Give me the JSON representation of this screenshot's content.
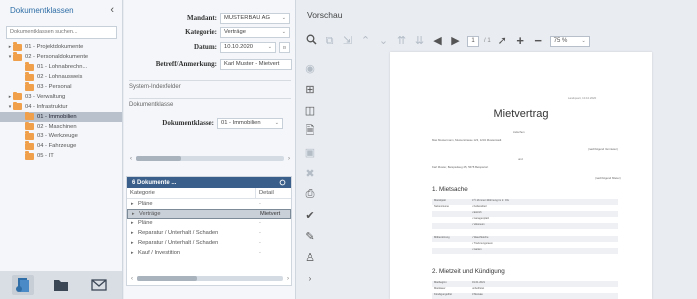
{
  "left": {
    "title": "Dokumentklassen",
    "collapse_icon": "chevron-left-icon",
    "search_placeholder": "Dokumentklassen suchen...",
    "tree": [
      {
        "label": "01 - Projektdokumente",
        "depth": 0,
        "toggle": "▸"
      },
      {
        "label": "02 - Personaldokumente",
        "depth": 0,
        "toggle": "▾"
      },
      {
        "label": "01 - Lohnabrechn...",
        "depth": 1,
        "toggle": ""
      },
      {
        "label": "02 - Lohnausweis",
        "depth": 1,
        "toggle": ""
      },
      {
        "label": "03 - Personal",
        "depth": 1,
        "toggle": ""
      },
      {
        "label": "03 - Verwaltung",
        "depth": 0,
        "toggle": "▸"
      },
      {
        "label": "04 - Infrastruktur",
        "depth": 0,
        "toggle": "▾"
      },
      {
        "label": "01 - Immobilien",
        "depth": 1,
        "toggle": "",
        "selected": true
      },
      {
        "label": "02 - Maschinen",
        "depth": 1,
        "toggle": ""
      },
      {
        "label": "03 - Werkzeuge",
        "depth": 1,
        "toggle": ""
      },
      {
        "label": "04 - Fahrzeuge",
        "depth": 1,
        "toggle": ""
      },
      {
        "label": "05 - IT",
        "depth": 1,
        "toggle": ""
      }
    ],
    "footer_icons": [
      "documents-icon",
      "folder-icon",
      "mail-icon"
    ]
  },
  "form": {
    "mandant_label": "Mandant:",
    "mandant_value": "MUSTERBAU AG",
    "kategorie_label": "Kategorie:",
    "kategorie_value": "Verträge",
    "datum_label": "Datum:",
    "datum_value": "10.10.2020",
    "betreff_label": "Betreff/Anmerkung:",
    "betreff_value": "Karl Muster - Mietvert",
    "section_system": "System-Indexfelder",
    "section_klasse": "Dokumentklasse",
    "dokumentklasse_label": "Dokumentklasse:",
    "dokumentklasse_value": "01 - Immobilien"
  },
  "docs": {
    "header": "6 Dokumente ...",
    "col_kategorie": "Kategorie",
    "col_detail": "Detail",
    "rows": [
      {
        "kategorie": "Pläne",
        "detail": "-"
      },
      {
        "kategorie": "Verträge",
        "detail": "Mietvert",
        "selected": true
      },
      {
        "kategorie": "Pläne",
        "detail": "-"
      },
      {
        "kategorie": "Reparatur / Unterhalt / Schaden",
        "detail": "-"
      },
      {
        "kategorie": "Reparatur / Unterhalt / Schaden",
        "detail": "-"
      },
      {
        "kategorie": "Kauf / Investition",
        "detail": "-"
      }
    ]
  },
  "preview": {
    "title": "Vorschau",
    "page_current": "1",
    "page_total": "/ 1",
    "zoom": "75 %"
  },
  "document": {
    "tiny_top": "Landquart, 10.10.2020",
    "title": "Mietvertrag",
    "line_between": "zwischen",
    "party1": "Max Mustermann, Musterstrasse 123, 1234 Musterstadt",
    "party1_role": "(nachfolgend Vermieter)",
    "line_und": "und",
    "party2": "Karl Muster, Beispielweg 45, 5678 Beispielort",
    "party2_role": "(nachfolgend Mieter)",
    "h1": "1. Mietsache",
    "t1": [
      {
        "k": "Mietobjekt",
        "v": "3 ½ Zimmer-Wohnung im 2. OG"
      },
      {
        "k": "Nebenräume",
        "v": "• Kellerabteil"
      },
      {
        "k": "",
        "v": "• Estrich"
      },
      {
        "k": "",
        "v": "• Garagenplatz"
      },
      {
        "k": "",
        "v": "• Veloraum"
      }
    ],
    "t1b": [
      {
        "k": "Mitbenützung",
        "v": "• Waschküche"
      },
      {
        "k": "",
        "v": "• Trocknungsraum"
      },
      {
        "k": "",
        "v": "• Garten"
      }
    ],
    "h2": "2. Mietzeit und Kündigung",
    "t2": [
      {
        "k": "Mietbeginn",
        "v": "01.01.2021"
      },
      {
        "k": "Mietdauer",
        "v": "unbefristet"
      },
      {
        "k": "Kündigungsfrist",
        "v": "3 Monate"
      }
    ]
  }
}
